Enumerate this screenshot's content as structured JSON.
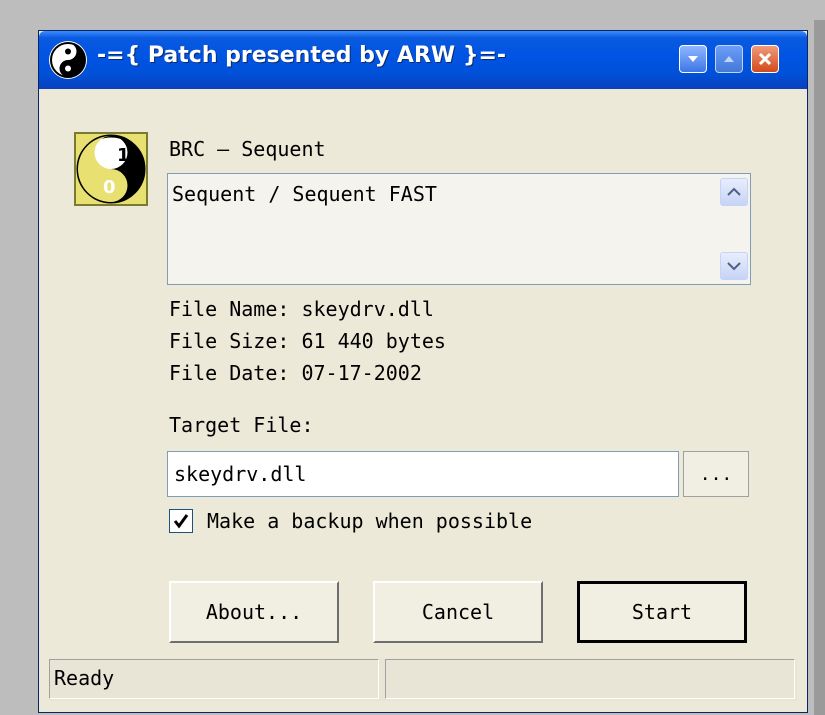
{
  "window": {
    "title": "-={ Patch presented by ARW }=-",
    "icon": "yin-yang-icon",
    "controls": [
      "minimize-icon",
      "maximize-icon",
      "close-icon"
    ]
  },
  "patch": {
    "product": "BRC – Sequent",
    "description": "Sequent / Sequent FAST",
    "file_name_line": "File Name: skeydrv.dll",
    "file_size_line": "File Size: 61 440 bytes",
    "file_date_line": "File Date: 07-17-2002",
    "badge_digits": [
      "1",
      "0"
    ]
  },
  "target": {
    "label": "Target File:",
    "value": "skeydrv.dll",
    "browse_label": "..."
  },
  "backup": {
    "label": "Make a backup when possible",
    "checked": true
  },
  "buttons": {
    "about": "About...",
    "cancel": "Cancel",
    "start": "Start"
  },
  "status": {
    "left": "Ready",
    "right": ""
  },
  "colors": {
    "titlebar": "#0054e3",
    "window_bg": "#ece9d8",
    "close_button": "#d24a1c"
  }
}
